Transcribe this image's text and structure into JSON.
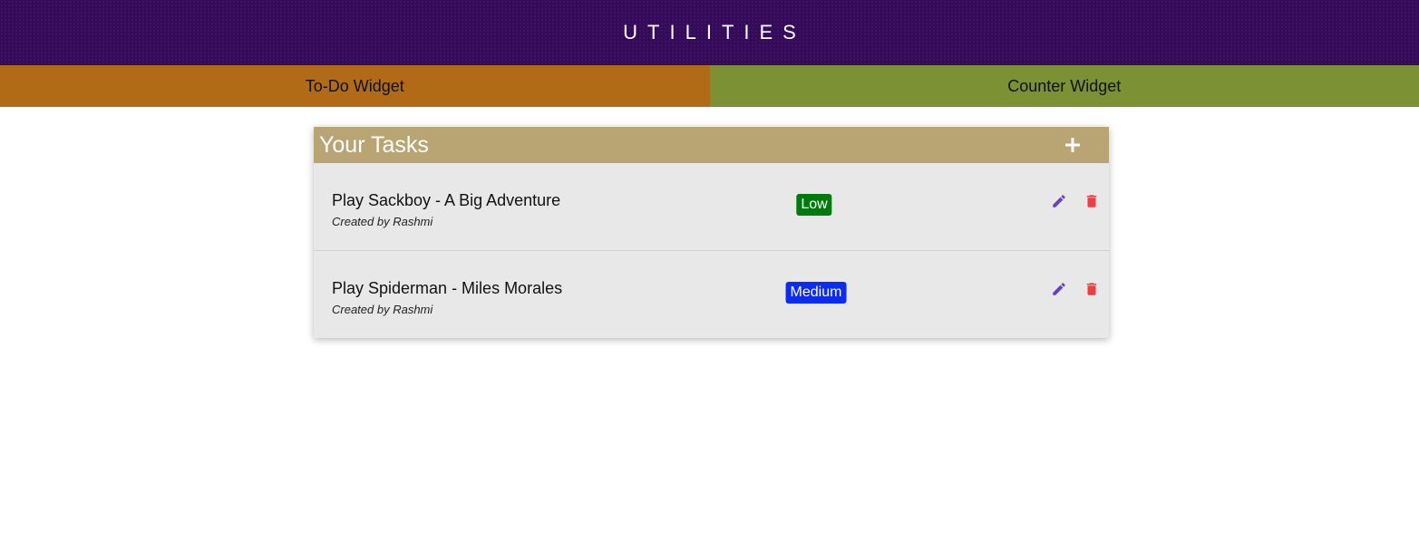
{
  "header": {
    "title": "UTILITIES",
    "background": "#350a5a"
  },
  "tabs": [
    {
      "label": "To-Do Widget",
      "color": "#b16b16"
    },
    {
      "label": "Counter Widget",
      "color": "#7b9133"
    }
  ],
  "tasks_panel": {
    "title": "Your Tasks",
    "add_icon": "plus-icon",
    "header_color": "#b9a574",
    "tasks": [
      {
        "title": "Play Sackboy - A Big Adventure",
        "created_by": "Created by Rashmi",
        "priority": "Low",
        "priority_color": "#007a0c",
        "edit_icon": "pencil-icon",
        "delete_icon": "trash-icon"
      },
      {
        "title": "Play Spiderman - Miles Morales",
        "created_by": "Created by Rashmi",
        "priority": "Medium",
        "priority_color": "#0a2cf5",
        "edit_icon": "pencil-icon",
        "delete_icon": "trash-icon"
      }
    ]
  },
  "colors": {
    "edit_icon": "#6a3dc4",
    "delete_icon": "#f03e3e"
  }
}
